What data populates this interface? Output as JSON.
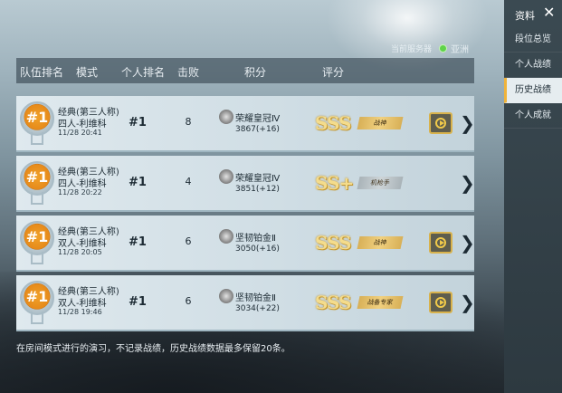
{
  "server": {
    "label": "当前服务器",
    "region": "亚洲",
    "region_color": "#5fd34a"
  },
  "table": {
    "headers": [
      "队伍排名",
      "模式",
      "个人排名",
      "击败",
      "积分",
      "评分"
    ],
    "rows": [
      {
        "team_rank": "#1",
        "mode_line1": "经典(第三人称)",
        "mode_line2": "四人-利维科",
        "time": "11/28 20:41",
        "personal_rank": "#1",
        "kills": "8",
        "tier": "荣耀皇冠Ⅳ",
        "tier_icon": "crown-tier-icon",
        "score": "3867(+16)",
        "grade": "SSS",
        "tag": "战神",
        "has_replay": true
      },
      {
        "team_rank": "#1",
        "mode_line1": "经典(第三人称)",
        "mode_line2": "四人-利维科",
        "time": "11/28 20:22",
        "personal_rank": "#1",
        "kills": "4",
        "tier": "荣耀皇冠Ⅳ",
        "tier_icon": "crown-tier-icon",
        "score": "3851(+12)",
        "grade": "SS+",
        "tag": "机枪手",
        "has_replay": false
      },
      {
        "team_rank": "#1",
        "mode_line1": "经典(第三人称)",
        "mode_line2": "双人-利维科",
        "time": "11/28 20:05",
        "personal_rank": "#1",
        "kills": "6",
        "tier": "坚韧铂金Ⅱ",
        "tier_icon": "platinum-tier-icon",
        "score": "3050(+16)",
        "grade": "SSS",
        "tag": "战神",
        "has_replay": true
      },
      {
        "team_rank": "#1",
        "mode_line1": "经典(第三人称)",
        "mode_line2": "双人-利维科",
        "time": "11/28 19:46",
        "personal_rank": "#1",
        "kills": "6",
        "tier": "坚韧铂金Ⅱ",
        "tier_icon": "platinum-tier-icon",
        "score": "3034(+22)",
        "grade": "SSS",
        "tag": "战备专家",
        "has_replay": true
      }
    ]
  },
  "footer_note": "在房间模式进行的演习，不记录战绩，历史战绩数据最多保留20条。",
  "sidebar": {
    "title": "资料",
    "close_icon": "close-icon",
    "items": [
      {
        "label": "段位总览",
        "active": false
      },
      {
        "label": "个人战绩",
        "active": false
      },
      {
        "label": "历史战绩",
        "active": true
      },
      {
        "label": "个人成就",
        "active": false
      }
    ]
  }
}
